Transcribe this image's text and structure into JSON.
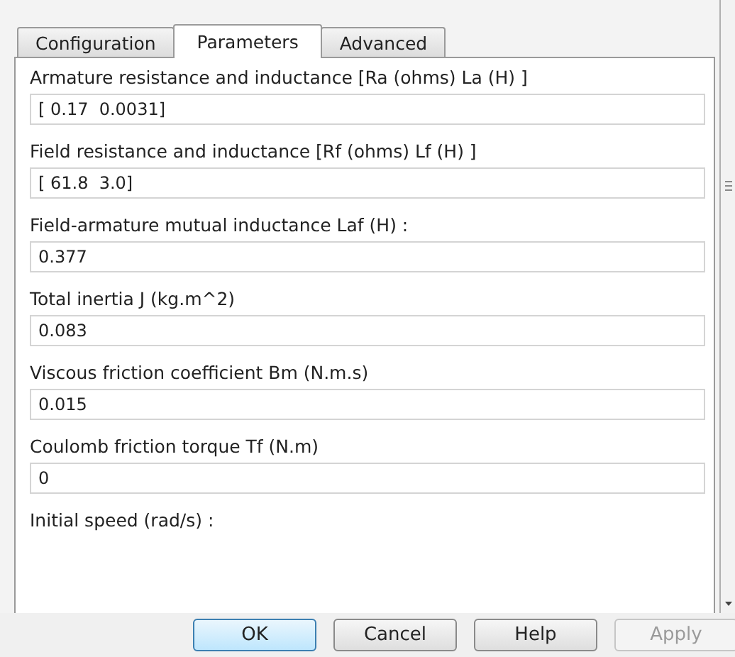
{
  "tabs": [
    {
      "label": "Configuration",
      "selected": false
    },
    {
      "label": "Parameters",
      "selected": true
    },
    {
      "label": "Advanced",
      "selected": false
    }
  ],
  "parameters": [
    {
      "label": "Armature resistance and inductance [Ra (ohms) La (H) ]",
      "value": "[ 0.17  0.0031]"
    },
    {
      "label": "Field resistance and inductance [Rf (ohms) Lf (H) ]",
      "value": "[ 61.8  3.0]"
    },
    {
      "label": "Field-armature mutual inductance Laf (H) :",
      "value": "0.377"
    },
    {
      "label": "Total inertia J (kg.m^2)",
      "value": "0.083"
    },
    {
      "label": "Viscous friction coefficient Bm (N.m.s)",
      "value": "0.015"
    },
    {
      "label": "Coulomb friction torque Tf (N.m)",
      "value": "0"
    },
    {
      "label": "Initial speed (rad/s) :"
    }
  ],
  "buttons": [
    {
      "label": "OK",
      "default": true,
      "disabled": false
    },
    {
      "label": "Cancel",
      "default": false,
      "disabled": false
    },
    {
      "label": "Help",
      "default": false,
      "disabled": false
    },
    {
      "label": "Apply",
      "default": false,
      "disabled": true
    }
  ]
}
